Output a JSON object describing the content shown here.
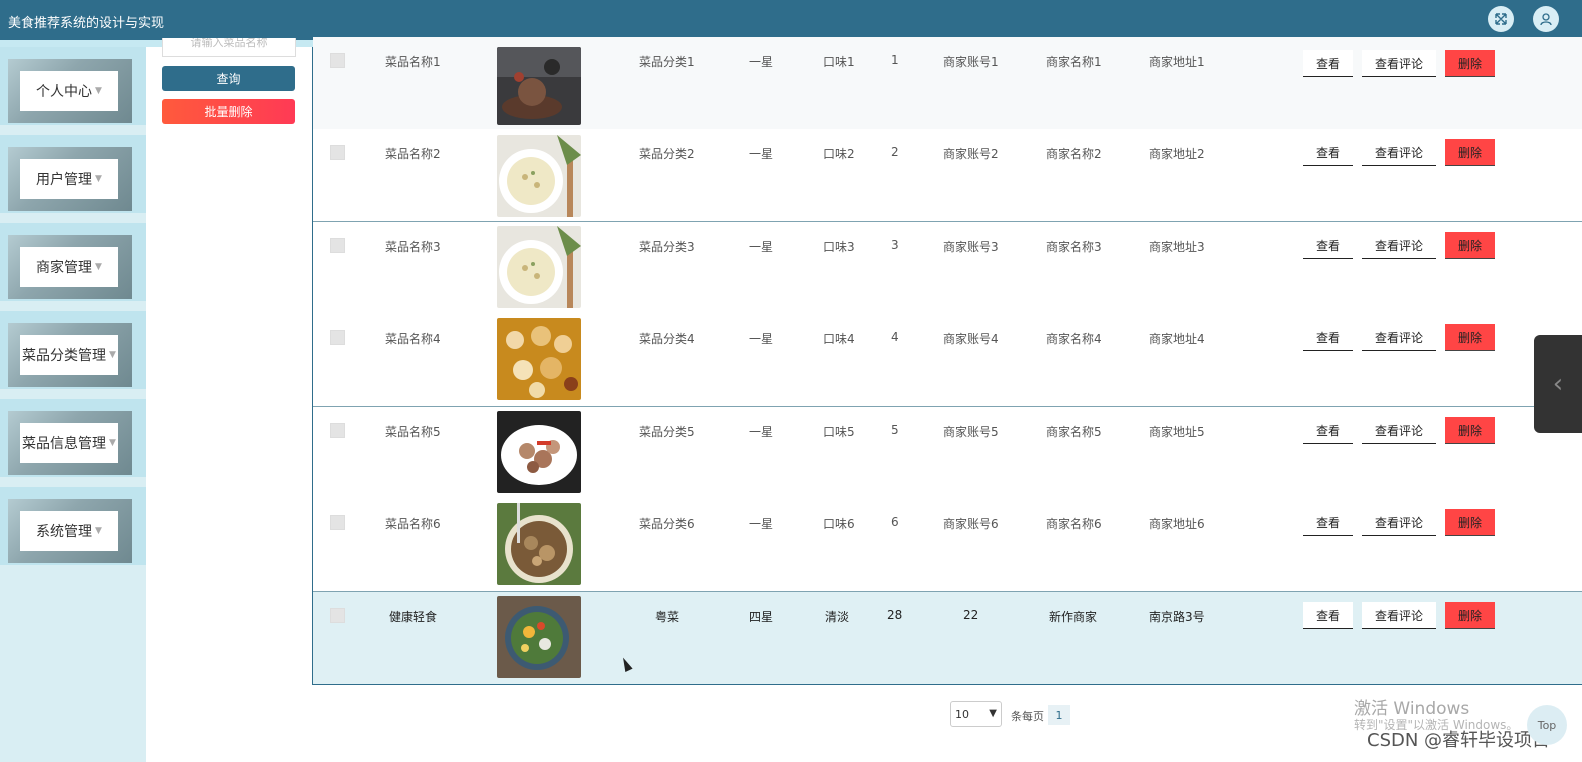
{
  "app": {
    "title": "美食推荐系统的设计与实现"
  },
  "sidebar": {
    "items": [
      {
        "label": "个人中心"
      },
      {
        "label": "用户管理"
      },
      {
        "label": "商家管理"
      },
      {
        "label": "菜品分类管理"
      },
      {
        "label": "菜品信息管理"
      },
      {
        "label": "系统管理"
      }
    ]
  },
  "search": {
    "input_text": "请输入菜品名称",
    "query_label": "查询",
    "batch_delete_label": "批量删除"
  },
  "table": {
    "rows": [
      {
        "name": "菜品名称1",
        "category": "菜品分类1",
        "rating": "一星",
        "taste": "口味1",
        "num": "1",
        "account": "商家账号1",
        "merchant": "商家名称1",
        "address": "商家地址1",
        "img": "plate-dark"
      },
      {
        "name": "菜品名称2",
        "category": "菜品分类2",
        "rating": "一星",
        "taste": "口味2",
        "num": "2",
        "account": "商家账号2",
        "merchant": "商家名称2",
        "address": "商家地址2",
        "img": "soup-bowl"
      },
      {
        "name": "菜品名称3",
        "category": "菜品分类3",
        "rating": "一星",
        "taste": "口味3",
        "num": "3",
        "account": "商家账号3",
        "merchant": "商家名称3",
        "address": "商家地址3",
        "img": "soup-bowl"
      },
      {
        "name": "菜品名称4",
        "category": "菜品分类4",
        "rating": "一星",
        "taste": "口味4",
        "num": "4",
        "account": "商家账号4",
        "merchant": "商家名称4",
        "address": "商家地址4",
        "img": "dim-sum"
      },
      {
        "name": "菜品名称5",
        "category": "菜品分类5",
        "rating": "一星",
        "taste": "口味5",
        "num": "5",
        "account": "商家账号5",
        "merchant": "商家名称5",
        "address": "商家地址5",
        "img": "meat-plate"
      },
      {
        "name": "菜品名称6",
        "category": "菜品分类6",
        "rating": "一星",
        "taste": "口味6",
        "num": "6",
        "account": "商家账号6",
        "merchant": "商家名称6",
        "address": "商家地址6",
        "img": "stew-bowl"
      },
      {
        "name": "健康轻食",
        "category": "粤菜",
        "rating": "四星",
        "taste": "清淡",
        "num": "28",
        "account": "22",
        "merchant": "新作商家",
        "address": "南京路3号",
        "img": "salad-bowl"
      }
    ],
    "actions": {
      "view": "查看",
      "view_comments": "查看评论",
      "delete": "删除"
    }
  },
  "pagination": {
    "page_size": "10",
    "per_page_label": "条每页",
    "current_page": "1"
  },
  "overlay": {
    "watermark_title": "激活 Windows",
    "watermark_sub": "转到\"设置\"以激活 Windows。",
    "csdn": "CSDN @睿轩毕设项目",
    "top_label": "Top"
  },
  "colors": {
    "header": "#2f6d8b",
    "danger": "#ff4545",
    "sidebar_bg": "#d9eef3"
  }
}
